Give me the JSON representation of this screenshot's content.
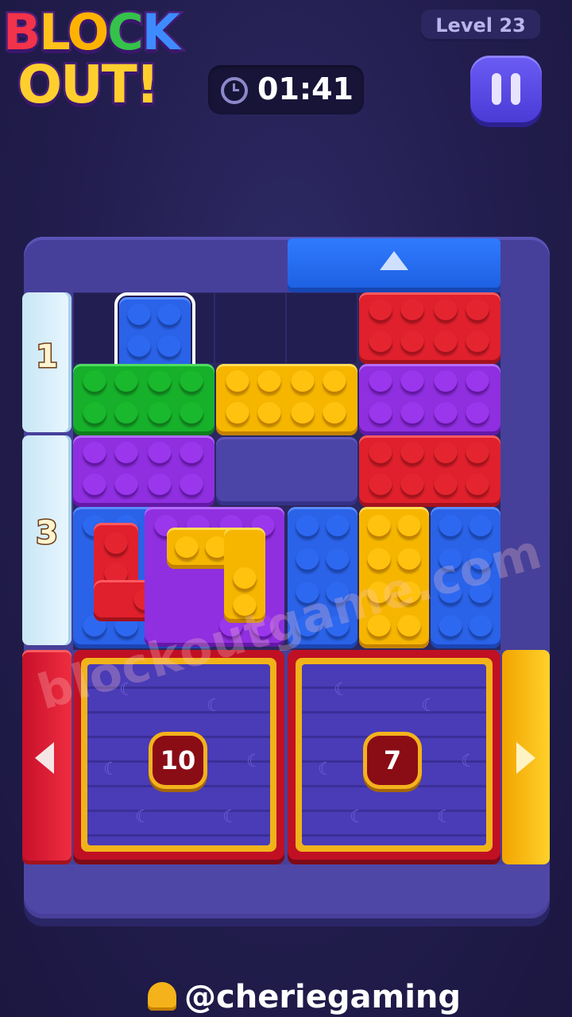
{
  "header": {
    "logo_line1": [
      "B",
      "L",
      "O",
      "C",
      "K"
    ],
    "logo_line2": [
      "O",
      "U",
      "T",
      "!"
    ],
    "level_label": "Level 23",
    "timer": "01:41"
  },
  "gates": {
    "left_top_number": "1",
    "left_mid_number": "3"
  },
  "crates": [
    {
      "count": "10"
    },
    {
      "count": "7"
    }
  ],
  "watermark": "blockoutgame.com",
  "credit": "@cheriegaming",
  "colors": {
    "blue": "#2a62e8",
    "red": "#e0202c",
    "green": "#17b02a",
    "yellow": "#f6b600",
    "purple": "#8f2fe0",
    "board": "#46409a"
  },
  "icons": {
    "timer": "clock-icon",
    "pause": "pause-icon",
    "credit": "bell-icon",
    "top_gate": "up-arrow-icon",
    "left_gate": "left-arrow-icon",
    "right_gate": "right-arrow-icon"
  }
}
